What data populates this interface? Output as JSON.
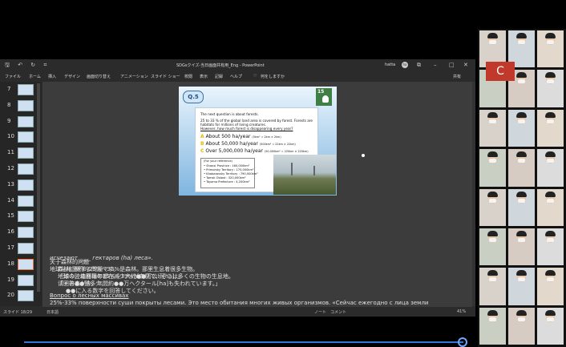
{
  "window": {
    "title": "SDGsクイズ-当日画面共有用_Eng - PowerPoint",
    "user": "hatta",
    "avatar": "ha",
    "controls": [
      "⧉",
      "–",
      "□",
      "✕"
    ]
  },
  "ribbon": {
    "tabs": [
      "ファイル",
      "ホーム",
      "挿入",
      "デザイン",
      "画面切り替え",
      "アニメーション",
      "スライド ショー",
      "校閲",
      "表示",
      "記録",
      "ヘルプ",
      "何をしますか"
    ],
    "share_label": "共有"
  },
  "thumbnails": [
    "7",
    "8",
    "9",
    "10",
    "11",
    "12",
    "13",
    "14",
    "15",
    "16",
    "17",
    "18",
    "19",
    "20"
  ],
  "selected_slide": "18",
  "slide": {
    "q_label": "Q.5",
    "sdg_number": "15",
    "intro": [
      "The next question is about forests.",
      "25 to 33 % of the global land area is covered by forest. Forests are",
      "habitats for millions of living creatures.",
      "However, how much forest is disappearing every year?"
    ],
    "options": [
      {
        "letter": "A",
        "text": "About       500 ha/year",
        "note": "(5km² = 2km × 2km)",
        "color": "#e6b800"
      },
      {
        "letter": "B",
        "text": "About    50,000 ha/year",
        "note": "(500km² = 22km × 22km)",
        "color": "#e6b800"
      },
      {
        "letter": "C",
        "text": "Over 5,000,000 ha/year",
        "note": "(50,000km² = 220km × 220km)",
        "color": "#e6b800"
      }
    ],
    "reference_title": "(For your reference)",
    "reference": [
      [
        "• Shanxi Province",
        ": 160,000km²"
      ],
      [
        "• Primorsky Territory",
        ": 170,000km²"
      ],
      [
        "• Khabarovsky Territory",
        ": 790,000km²"
      ],
      [
        "• Tomsk Oblast",
        ": 320,000km²"
      ],
      [
        "• Toyama Prefecture",
        ": 4,200km²"
      ]
    ]
  },
  "notes": {
    "zh": [
      "关于森林的问题",
      "地球陆地面积的25%～33%是森林。那里生息着很多生物。",
      "「如今，森林每年都在减少大约●●万公顷[ha]。」",
      "请回答●●是多少。"
    ],
    "ru_heading": "Вопрос о лесных массивах",
    "ru_1": "25%-33% поверхности суши покрыты лесами. Это место обитания многих живых организмов. «Сейчас ежегодно с лица земли",
    "ru_2": "исчезают ____ гектаров (ha) леса».",
    "ja": [
      "森林に関する問題です。",
      "地球の陸地面積の25%～33%が森林で、そこは多くの生物の生息地。",
      "「その森が今、年間約●●万ヘクタール[ha]も失われています。」",
      "●●に入る数字を回答してください。"
    ]
  },
  "status": {
    "slide": "スライド 18/29",
    "lang": "日本語",
    "notes_label": "ノート",
    "comments_label": "コメント",
    "zoom": "41%"
  },
  "participants": {
    "count": 24,
    "letter_tile": "C",
    "letter_color": "#c0392b"
  }
}
